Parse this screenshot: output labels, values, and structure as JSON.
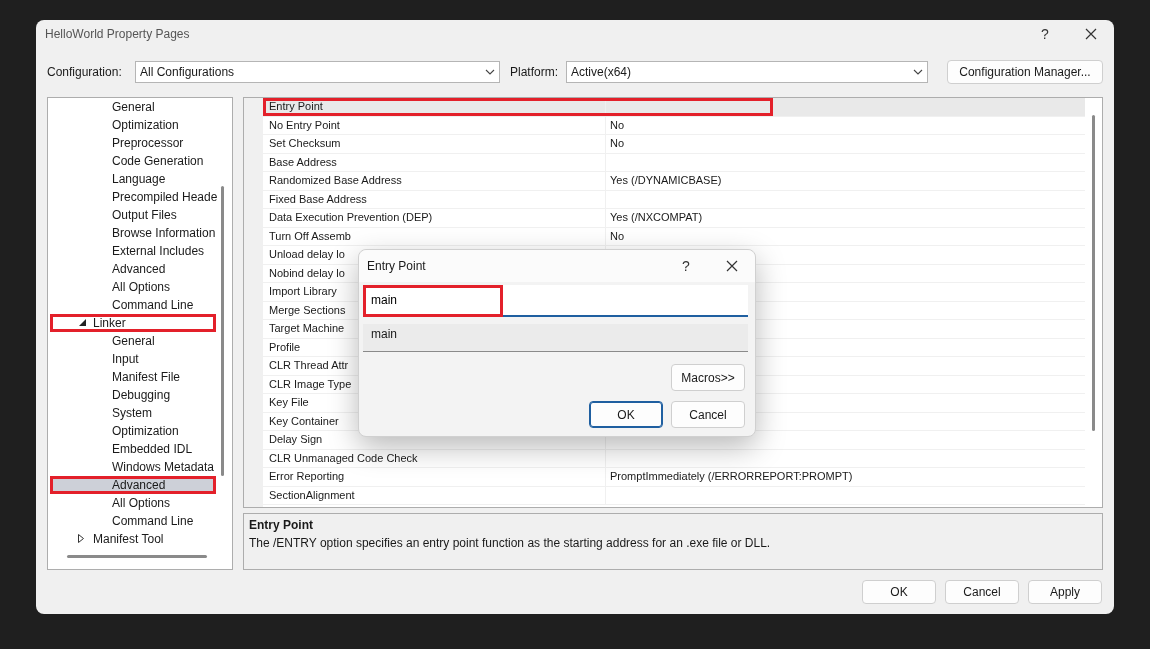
{
  "window": {
    "title": "HelloWorld Property Pages",
    "help": "?"
  },
  "config": {
    "configuration_label": "Configuration:",
    "configuration": "All Configurations",
    "platform_label": "Platform:",
    "platform": "Active(x64)",
    "manager_button": "Configuration Manager..."
  },
  "tree": {
    "items": [
      {
        "children": [
          {
            "label": "General",
            "selected": false,
            "annotated": false
          },
          {
            "label": "Optimization",
            "selected": false,
            "annotated": false
          },
          {
            "label": "Preprocessor",
            "selected": false,
            "annotated": false
          },
          {
            "label": "Code Generation",
            "selected": false,
            "annotated": false
          },
          {
            "label": "Language",
            "selected": false,
            "annotated": false
          },
          {
            "label": "Precompiled Heade",
            "selected": false,
            "annotated": false
          },
          {
            "label": "Output Files",
            "selected": false,
            "annotated": false
          },
          {
            "label": "Browse Information",
            "selected": false,
            "annotated": false
          },
          {
            "label": "External Includes",
            "selected": false,
            "annotated": false
          },
          {
            "label": "Advanced",
            "selected": false,
            "annotated": false
          },
          {
            "label": "All Options",
            "selected": false,
            "annotated": false
          },
          {
            "label": "Command Line",
            "selected": false,
            "annotated": false
          }
        ]
      },
      {
        "label": "Linker",
        "expanded": true,
        "selected": false,
        "annotated": true,
        "children": [
          {
            "label": "General",
            "selected": false,
            "annotated": false
          },
          {
            "label": "Input",
            "selected": false,
            "annotated": false
          },
          {
            "label": "Manifest File",
            "selected": false,
            "annotated": false
          },
          {
            "label": "Debugging",
            "selected": false,
            "annotated": false
          },
          {
            "label": "System",
            "selected": false,
            "annotated": false
          },
          {
            "label": "Optimization",
            "selected": false,
            "annotated": false
          },
          {
            "label": "Embedded IDL",
            "selected": false,
            "annotated": false
          },
          {
            "label": "Windows Metadata",
            "selected": false,
            "annotated": false
          },
          {
            "label": "Advanced",
            "selected": true,
            "annotated": true
          },
          {
            "label": "All Options",
            "selected": false,
            "annotated": false
          },
          {
            "label": "Command Line",
            "selected": false,
            "annotated": false
          }
        ]
      },
      {
        "label": "Manifest Tool",
        "expanded": false,
        "selected": false,
        "annotated": false
      }
    ]
  },
  "grid": {
    "rows": [
      {
        "name": "Entry Point",
        "selected": true,
        "annotated": true
      },
      {
        "name": "No Entry Point",
        "value": "No",
        "selected": false,
        "annotated": false
      },
      {
        "name": "Set Checksum",
        "value": "No",
        "selected": false,
        "annotated": false
      },
      {
        "name": "Base Address",
        "selected": false,
        "annotated": false
      },
      {
        "name": "Randomized Base Address",
        "value": "Yes (/DYNAMICBASE)",
        "selected": false,
        "annotated": false
      },
      {
        "name": "Fixed Base Address",
        "selected": false,
        "annotated": false
      },
      {
        "name": "Data Execution Prevention (DEP)",
        "value": "Yes (/NXCOMPAT)",
        "selected": false,
        "annotated": false
      },
      {
        "name": "Turn Off Assemb",
        "value": "No",
        "selected": false,
        "annotated": false
      },
      {
        "name": "Unload delay lo",
        "selected": false,
        "annotated": false
      },
      {
        "name": "Nobind delay lo",
        "selected": false,
        "annotated": false
      },
      {
        "name": "Import Library",
        "selected": false,
        "annotated": false
      },
      {
        "name": "Merge Sections",
        "selected": false,
        "annotated": false
      },
      {
        "name": "Target Machine",
        "selected": false,
        "annotated": false
      },
      {
        "name": "Profile",
        "selected": false,
        "annotated": false
      },
      {
        "name": "CLR Thread Attr",
        "selected": false,
        "annotated": false
      },
      {
        "name": "CLR Image Type",
        "selected": false,
        "annotated": false
      },
      {
        "name": "Key File",
        "selected": false,
        "annotated": false
      },
      {
        "name": "Key Container",
        "selected": false,
        "annotated": false
      },
      {
        "name": "Delay Sign",
        "selected": false,
        "annotated": false
      },
      {
        "name": "CLR Unmanaged Code Check",
        "selected": false,
        "annotated": false
      },
      {
        "name": "Error Reporting",
        "value": "PromptImmediately (/ERRORREPORT:PROMPT)",
        "selected": false,
        "annotated": false
      },
      {
        "name": "SectionAlignment",
        "selected": false,
        "annotated": false
      }
    ]
  },
  "description": {
    "title": "Entry Point",
    "text": "The /ENTRY option specifies an entry point function as the starting address for an .exe file or DLL."
  },
  "buttons": [
    "OK",
    "Cancel",
    "Apply"
  ],
  "dialog": {
    "title": "Entry Point",
    "help": "?",
    "value": "main",
    "value_annotated": true,
    "preview": "main",
    "macros_button": "Macros>>",
    "buttons": [
      {
        "label": "OK",
        "default": true
      },
      {
        "label": "Cancel",
        "default": false
      }
    ]
  }
}
